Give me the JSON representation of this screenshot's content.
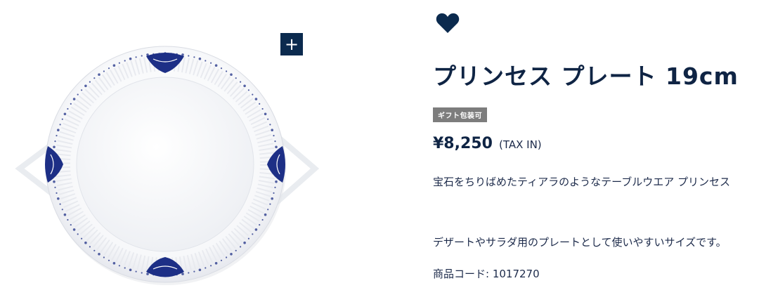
{
  "gallery": {
    "image_alt": "Princess plate 19cm",
    "zoom_icon": "plus-icon"
  },
  "product": {
    "favorite_icon": "heart-icon",
    "title": "プリンセス プレート 19cm",
    "badge": "ギフト包装可",
    "price": "¥8,250",
    "tax_note": "(TAX IN)",
    "description": "宝石をちりばめたティアラのようなテーブルウエア プリンセス",
    "detail": "デザートやサラダ用のプレートとして使いやすいサイズです。",
    "code": "商品コード: 1017270"
  },
  "colors": {
    "navy": "#0b2a4e",
    "pattern_blue": "#1d2f86",
    "badge_gray": "#7d7d7d"
  }
}
